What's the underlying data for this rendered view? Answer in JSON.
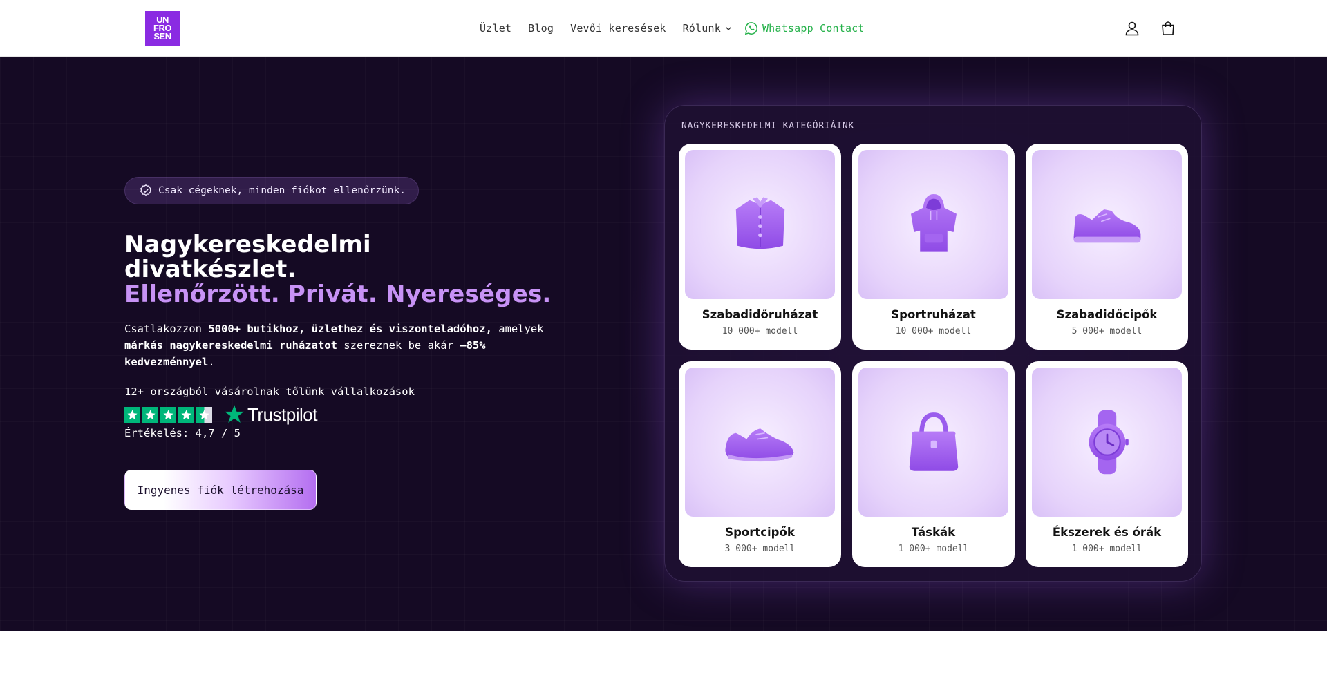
{
  "header": {
    "logo_lines": [
      "UN",
      "FRO",
      "SEN"
    ],
    "nav": [
      {
        "label": "Üzlet"
      },
      {
        "label": "Blog"
      },
      {
        "label": "Vevői keresések"
      },
      {
        "label": "Rólunk"
      }
    ],
    "whatsapp_label": "Whatsapp Contact",
    "icons": [
      "account-icon",
      "cart-icon"
    ]
  },
  "hero": {
    "badge": "Csak cégeknek, minden fiókot ellenőrzünk.",
    "headline_line1": "Nagykereskedelmi",
    "headline_line2": "divatkészlet.",
    "headline_accent": "Ellenőrzött. Privát. Nyereséges.",
    "intro_1": "Csatlakozzon ",
    "intro_2": "5000+ butikhoz, üzlethez és viszonteladóhoz,",
    "intro_3": " amelyek ",
    "intro_4": "márkás nagykereskedelmi ruházatot",
    "intro_5": " szereznek be akár ",
    "intro_6": "–85% kedvezménnyel",
    "intro_7": ".",
    "countries": "12+ országból vásárolnak tőlünk vállalkozások",
    "trustpilot_label": "Trustpilot",
    "trustpilot_stars": 4.5,
    "rating": "Értékelés: 4,7 / 5",
    "cta": "Ingyenes fiók létrehozása"
  },
  "categories": {
    "title": "NAGYKERESKEDELMI KATEGÓRIÁINK",
    "items": [
      {
        "name": "Szabadidőruházat",
        "count": "10 000+ modell",
        "icon": "shirt-icon"
      },
      {
        "name": "Sportruházat",
        "count": "10 000+ modell",
        "icon": "hoodie-icon"
      },
      {
        "name": "Szabadidőcipők",
        "count": "5 000+ modell",
        "icon": "casual-shoe-icon"
      },
      {
        "name": "Sportcipők",
        "count": "3 000+ modell",
        "icon": "sneaker-icon"
      },
      {
        "name": "Táskák",
        "count": "1 000+ modell",
        "icon": "bag-icon"
      },
      {
        "name": "Ékszerek és órák",
        "count": "1 000+ modell",
        "icon": "watch-icon"
      }
    ]
  },
  "colors": {
    "brand": "#8a2be2",
    "accent": "#c792f5",
    "hero_bg": "#150a24",
    "whatsapp": "#25b14a",
    "trustpilot": "#00b67a"
  }
}
